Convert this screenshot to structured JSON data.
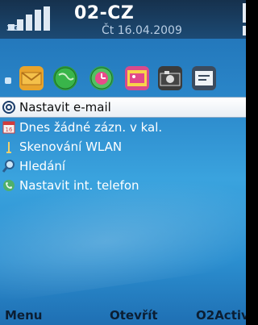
{
  "status": {
    "operator": "02-CZ",
    "network": "3G",
    "date": "Čt 16.04.2009"
  },
  "shortcuts": [
    {
      "icon": "mail-icon"
    },
    {
      "icon": "globe-icon"
    },
    {
      "icon": "clock-icon"
    },
    {
      "icon": "gallery-icon"
    },
    {
      "icon": "camera-icon"
    },
    {
      "icon": "settings-icon"
    }
  ],
  "list": [
    {
      "label": "Nastavit e-mail",
      "icon": "at-icon"
    },
    {
      "label": "Dnes žádné zázn. v kal.",
      "icon": "calendar-icon"
    },
    {
      "label": "Skenování WLAN",
      "icon": "wlan-icon"
    },
    {
      "label": "Hledání",
      "icon": "search-icon"
    },
    {
      "label": "Nastavit int. telefon",
      "icon": "phone-icon"
    }
  ],
  "softkeys": {
    "left": "Menu",
    "center": "Otevřít",
    "right": "O2Activ"
  },
  "colors": {
    "background_top": "#1f6fb3",
    "background_mid": "#3aa3de",
    "selection": "#ffffff",
    "statusbar": "#16314d"
  }
}
